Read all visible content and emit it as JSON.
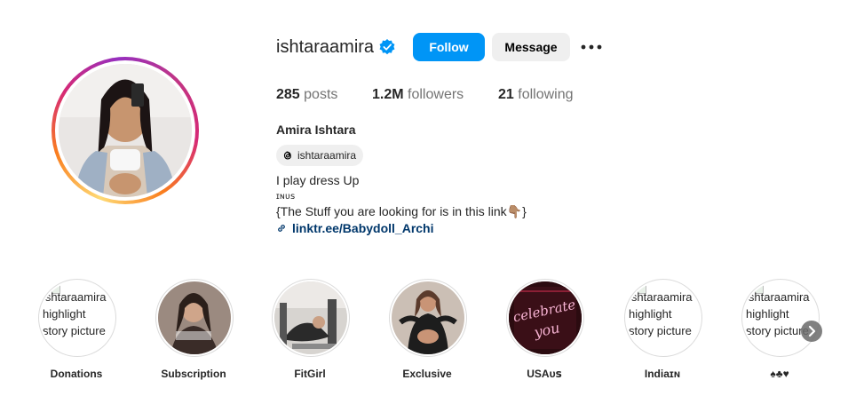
{
  "profile": {
    "username": "ishtaraamira",
    "follow_label": "Follow",
    "message_label": "Message",
    "stats": {
      "posts_count": "285",
      "posts_label": "posts",
      "followers_count": "1.2M",
      "followers_label": "followers",
      "following_count": "21",
      "following_label": "following"
    },
    "full_name": "Amira Ishtara",
    "threads_handle": "ishtaraamira",
    "bio_line1": "I play dress Up",
    "bio_line2": "ɪɴᴜꜱ",
    "bio_line3": "{The Stuff you are looking for is in this link👇🏽}",
    "link": "linktr.ee/Babydoll_Archi"
  },
  "highlights": [
    {
      "label": "Donations",
      "alt": [
        "ishtaraamira",
        "highlight",
        "story picture"
      ],
      "image": "broken"
    },
    {
      "label": "Subscription",
      "image": "photo"
    },
    {
      "label": "FitGirl",
      "image": "photo"
    },
    {
      "label": "Exclusive",
      "image": "photo"
    },
    {
      "label": "USAᴜꜱ",
      "image": "neon-celebrate-you"
    },
    {
      "label": "Indiaɪɴ",
      "alt": [
        "ishtaraamira",
        "highlight",
        "story picture"
      ],
      "image": "broken"
    },
    {
      "label": "♠♣♥",
      "alt": [
        "ishtaraamira",
        "highlight",
        "story picture"
      ],
      "image": "broken"
    }
  ],
  "neon_text": "celebrate you",
  "icons": {
    "verified": "verified-badge-icon",
    "more": "more-options-icon",
    "threads": "threads-icon",
    "link": "link-icon",
    "next": "chevron-right-icon"
  },
  "colors": {
    "follow_button": "#0095f6",
    "message_button": "#efefef",
    "link": "#00376b",
    "verified": "#0095f6"
  }
}
